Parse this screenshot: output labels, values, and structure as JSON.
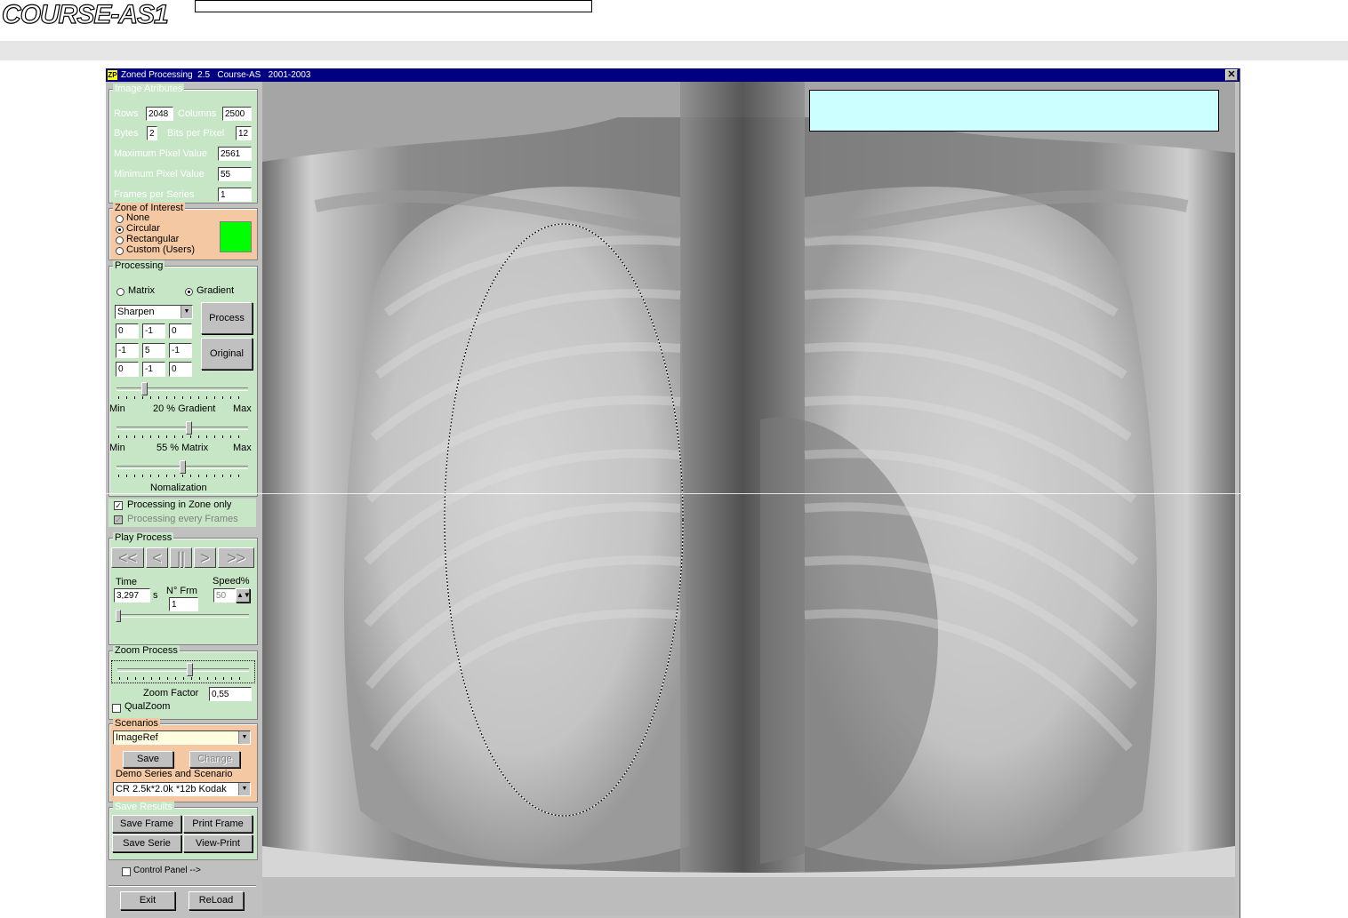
{
  "header": {
    "logo_text": "COURSE-AS1"
  },
  "window": {
    "title_icon": "ZP",
    "title": "Zoned Processing  2.5   Course-AS   2001-2003",
    "close_label": "✕"
  },
  "image_attributes": {
    "title": "Image  Atributes",
    "rows_label": "Rows",
    "rows_value": "2048",
    "columns_label": "Columns",
    "columns_value": "2500",
    "bytes_label": "Bytes",
    "bytes_value": "2",
    "bpp_label": "Bits per Pixel",
    "bpp_value": "12",
    "max_label": "Maximum Pixel Value",
    "max_value": "2561",
    "min_label": "Minimum Pixel Value",
    "min_value": "55",
    "frames_label": "Frames per Series",
    "frames_value": "1"
  },
  "zone": {
    "title": "Zone of Interest",
    "options": [
      "None",
      "Circular",
      "Rectangular",
      "Custom (Users)"
    ],
    "selected": "Circular",
    "color": "#00ff00"
  },
  "processing": {
    "title": "Processing",
    "matrix_label": "Matrix",
    "gradient_label": "Gradient",
    "mode_selected": "Gradient",
    "filter": "Sharpen",
    "kernel": [
      [
        "0",
        "-1",
        "0"
      ],
      [
        "-1",
        "5",
        "-1"
      ],
      [
        "0",
        "-1",
        "0"
      ]
    ],
    "process_label": "Process",
    "original_label": "Original",
    "gradient_slider": {
      "min": "Min",
      "max": "Max",
      "label": "20 % Gradient",
      "value": 0.2
    },
    "matrix_slider": {
      "min": "Min",
      "max": "Max",
      "label": "55 % Matrix",
      "value": 0.55
    },
    "norm_slider": {
      "label": "Nomalization",
      "value": 0.5
    },
    "zone_only_label": "Processing in Zone only",
    "zone_only_checked": true,
    "every_frames_label": "Processing every Frames"
  },
  "play": {
    "title": "Play  Process",
    "buttons": [
      "<<",
      "<",
      "||",
      ">",
      ">>"
    ],
    "time_label": "Time",
    "time_value": "3,297",
    "time_unit": "s",
    "frm_label": "N° Frm",
    "frm_value": "1",
    "speed_label": "Speed%",
    "speed_value": "50"
  },
  "zoom": {
    "title": "Zoom  Process",
    "factor_label": "Zoom Factor",
    "factor_value": "0,55",
    "qual_label": "QualZoom",
    "slider_value": 0.55
  },
  "scenarios": {
    "title": "Scenarios",
    "selected": "ImageRef",
    "save_label": "Save",
    "change_label": "Change",
    "demo_label": "Demo Series and Scenario",
    "demo_value": "CR 2.5k*2.0k *12b Kodak"
  },
  "save_results": {
    "title": "Save  Results",
    "save_frame": "Save Frame",
    "print_frame": "Print Frame",
    "save_serie": "Save Serie",
    "view_print": "View-Print"
  },
  "control_panel_label": "Control Panel -->",
  "exit_label": "Exit",
  "reload_label": "ReLoad"
}
